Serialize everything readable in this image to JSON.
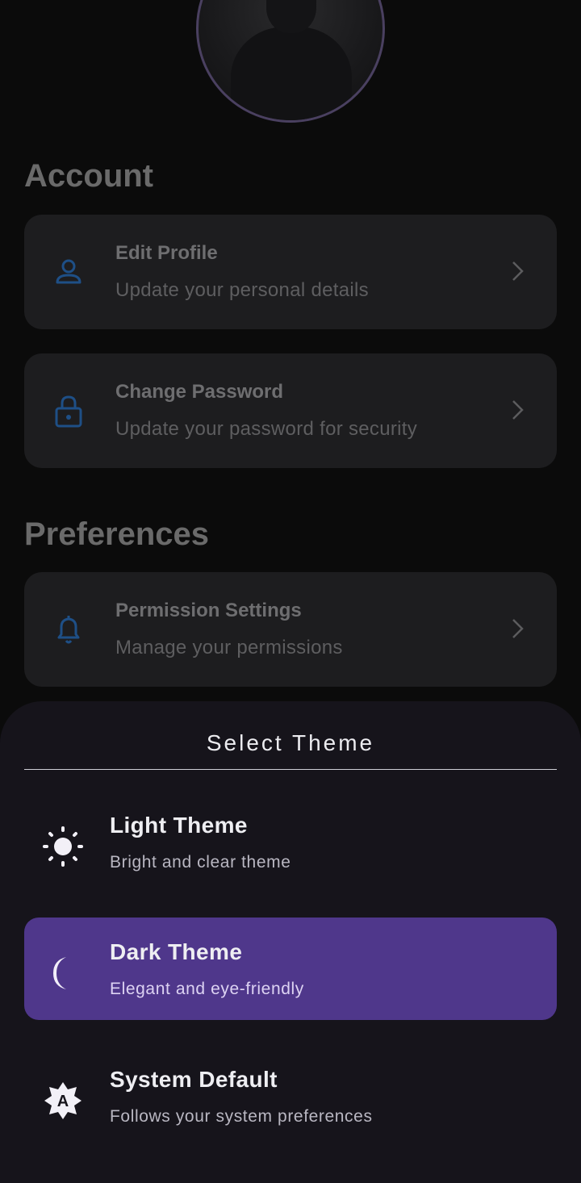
{
  "sections": {
    "account_title": "Account",
    "preferences_title": "Preferences"
  },
  "account": {
    "items": [
      {
        "title": "Edit Profile",
        "subtitle": "Update your personal details",
        "icon": "person-icon"
      },
      {
        "title": "Change Password",
        "subtitle": "Update your password for security",
        "icon": "lock-icon"
      }
    ]
  },
  "preferences": {
    "items": [
      {
        "title": "Permission Settings",
        "subtitle": "Manage your permissions",
        "icon": "bell-icon"
      }
    ]
  },
  "theme_sheet": {
    "title": "Select Theme",
    "selected": "Dark Theme",
    "options": [
      {
        "title": "Light Theme",
        "subtitle": "Bright and clear theme",
        "icon": "sun-icon"
      },
      {
        "title": "Dark Theme",
        "subtitle": "Elegant and eye-friendly",
        "icon": "moon-icon"
      },
      {
        "title": "System Default",
        "subtitle": "Follows your system preferences",
        "icon": "auto-brightness-icon"
      }
    ]
  },
  "colors": {
    "background": "#0b0b0b",
    "card": "#1d1d1f",
    "icon_accent": "#1e4f86",
    "sheet": "#16141b",
    "selected": "#4f378b"
  }
}
